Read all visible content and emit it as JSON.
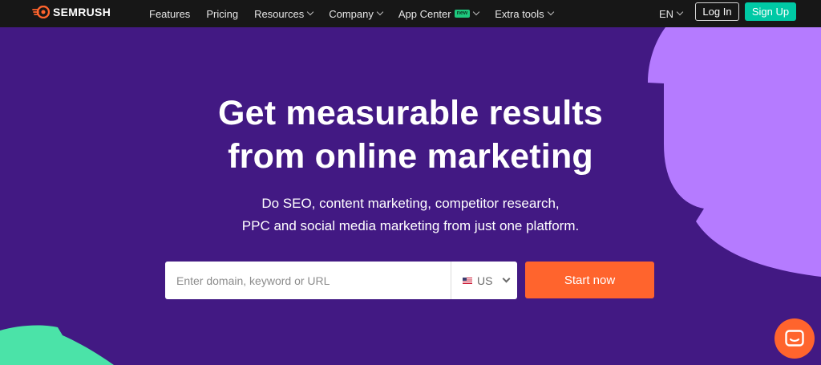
{
  "brand": {
    "name": "SEMRUSH"
  },
  "nav": {
    "items": [
      {
        "label": "Features",
        "has_dropdown": false
      },
      {
        "label": "Pricing",
        "has_dropdown": false
      },
      {
        "label": "Resources",
        "has_dropdown": true
      },
      {
        "label": "Company",
        "has_dropdown": true
      },
      {
        "label": "App Center",
        "badge": "new",
        "has_dropdown": true
      },
      {
        "label": "Extra tools",
        "has_dropdown": true
      }
    ],
    "language": "EN",
    "login_label": "Log In",
    "signup_label": "Sign Up"
  },
  "hero": {
    "headline_line1": "Get measurable results",
    "headline_line2": "from online marketing",
    "sub_line1": "Do SEO, content marketing, competitor research,",
    "sub_line2": "PPC and social media marketing from just one platform."
  },
  "search": {
    "placeholder": "Enter domain, keyword or URL",
    "value": "",
    "country": "US",
    "submit_label": "Start now"
  },
  "colors": {
    "background": "#421983",
    "nav_background": "#171717",
    "accent_orange": "#ff642d",
    "accent_teal": "#00c9a5",
    "deco_purple": "#b57bff",
    "deco_green": "#4be3a8"
  },
  "icons": {
    "logo": "semrush-flame-icon",
    "flag": "us-flag-icon",
    "chat": "chat-icon"
  }
}
